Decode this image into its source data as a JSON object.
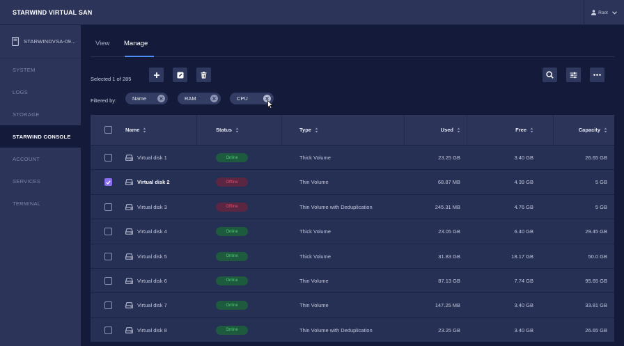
{
  "app": {
    "title": "STARWIND VIRTUAL SAN",
    "user": "Root"
  },
  "sidebar": {
    "node_name": "STARWINDVSA-09...",
    "items": [
      {
        "label": "SYSTEM",
        "active": false
      },
      {
        "label": "LOGS",
        "active": false
      },
      {
        "label": "STORAGE",
        "active": false
      },
      {
        "label": "STARWIND CONSOLE",
        "active": true
      },
      {
        "label": "ACCOUNT",
        "active": false
      },
      {
        "label": "SERVICES",
        "active": false
      },
      {
        "label": "TERMINAL",
        "active": false
      }
    ]
  },
  "tabs": {
    "view": "View",
    "manage": "Manage",
    "active": "manage"
  },
  "toolbar": {
    "selected_text": "Selected 1 of 285"
  },
  "filters": {
    "label": "Filtered by:",
    "chips": [
      "Name",
      "RAM",
      "CPU"
    ]
  },
  "table": {
    "headers": {
      "name": "Name",
      "status": "Status",
      "type": "Type",
      "used": "Used",
      "free": "Free",
      "capacity": "Capacity"
    },
    "rows": [
      {
        "checked": false,
        "name": "Virtual disk 1",
        "status": "Online",
        "type": "Thick Volume",
        "used": "23.25 GB",
        "free": "3.40 GB",
        "capacity": "26.65 GB"
      },
      {
        "checked": true,
        "name": "Virtual disk 2",
        "status": "Offline",
        "type": "Thin Volume",
        "used": "68.87 MB",
        "free": "4.39 GB",
        "capacity": "5 GB"
      },
      {
        "checked": false,
        "name": "Virtual disk 3",
        "status": "Offline",
        "type": "Thin Volume with Deduplication",
        "used": "245.31 MB",
        "free": "4.76 GB",
        "capacity": "5 GB"
      },
      {
        "checked": false,
        "name": "Virtual disk 4",
        "status": "Online",
        "type": "Thick Volume",
        "used": "23.05 GB",
        "free": "6.40 GB",
        "capacity": "29.45 GB"
      },
      {
        "checked": false,
        "name": "Virtual disk 5",
        "status": "Online",
        "type": "Thick Volume",
        "used": "31.83 GB",
        "free": "18.17 GB",
        "capacity": "50.0 GB"
      },
      {
        "checked": false,
        "name": "Virtual disk 6",
        "status": "Online",
        "type": "Thin Volume",
        "used": "87.13 GB",
        "free": "7.74 GB",
        "capacity": "95.65 GB"
      },
      {
        "checked": false,
        "name": "Virtual disk 7",
        "status": "Online",
        "type": "Thin Volume",
        "used": "147.25 MB",
        "free": "3.40 GB",
        "capacity": "33.81 GB"
      },
      {
        "checked": false,
        "name": "Virtual disk 8",
        "status": "Online",
        "type": "Thin Volume with Deduplication",
        "used": "23.25 GB",
        "free": "3.40 GB",
        "capacity": "26.65 GB"
      }
    ]
  },
  "colors": {
    "accent": "#4d8df7",
    "online": "#44d36e",
    "offline": "#f2466a",
    "checkbox": "#8a6ef0"
  },
  "icons": [
    "user-icon",
    "chevron-down-icon",
    "server-icon",
    "plus-icon",
    "edit-icon",
    "trash-icon",
    "search-icon",
    "sliders-icon",
    "more-icon",
    "close-icon",
    "sort-icon",
    "disk-icon",
    "check-icon",
    "cursor-icon"
  ]
}
